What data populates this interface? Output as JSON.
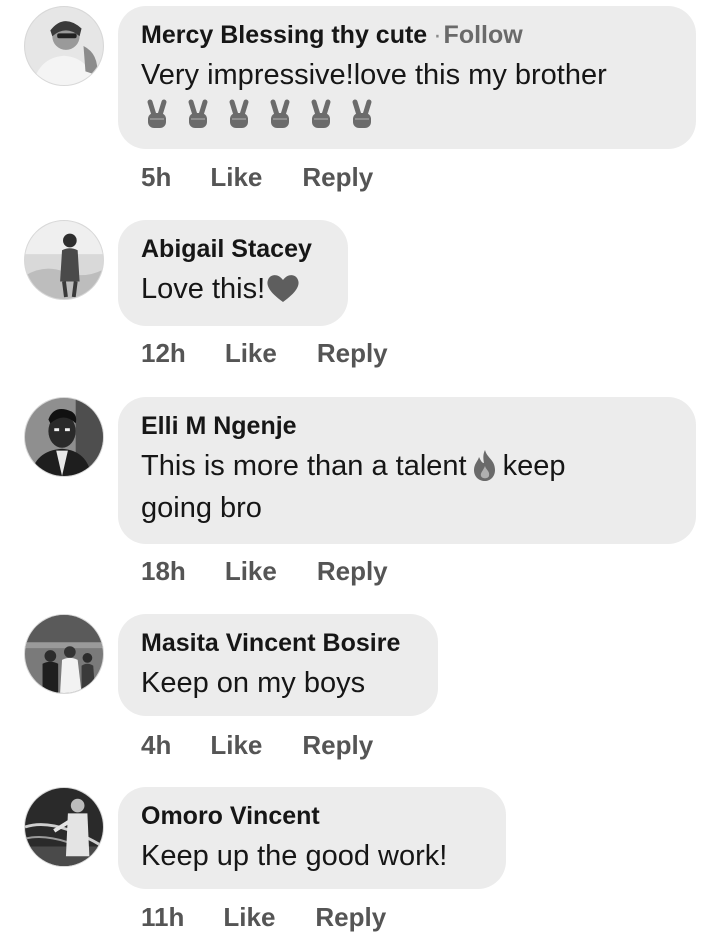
{
  "comments": [
    {
      "author": "Mercy Blessing thy cute",
      "follow": "Follow",
      "text": "Very impressive!love this my brother",
      "emojis": [
        "victory-hand",
        "victory-hand",
        "victory-hand",
        "victory-hand",
        "victory-hand",
        "victory-hand"
      ],
      "time": "5h",
      "like": "Like",
      "reply": "Reply"
    },
    {
      "author": "Abigail Stacey",
      "text": "Love this!",
      "emoji": "heart",
      "time": "12h",
      "like": "Like",
      "reply": "Reply"
    },
    {
      "author": "Elli M Ngenje",
      "text_before": "This is more than a talent",
      "emoji": "fire",
      "text_after": "keep",
      "text_line2": "going bro",
      "time": "18h",
      "like": "Like",
      "reply": "Reply"
    },
    {
      "author": "Masita Vincent Bosire",
      "text": "Keep on my boys",
      "time": "4h",
      "like": "Like",
      "reply": "Reply"
    },
    {
      "author": "Omoro Vincent",
      "text": "Keep up the good work!",
      "time": "11h",
      "like": "Like",
      "reply": "Reply"
    }
  ]
}
